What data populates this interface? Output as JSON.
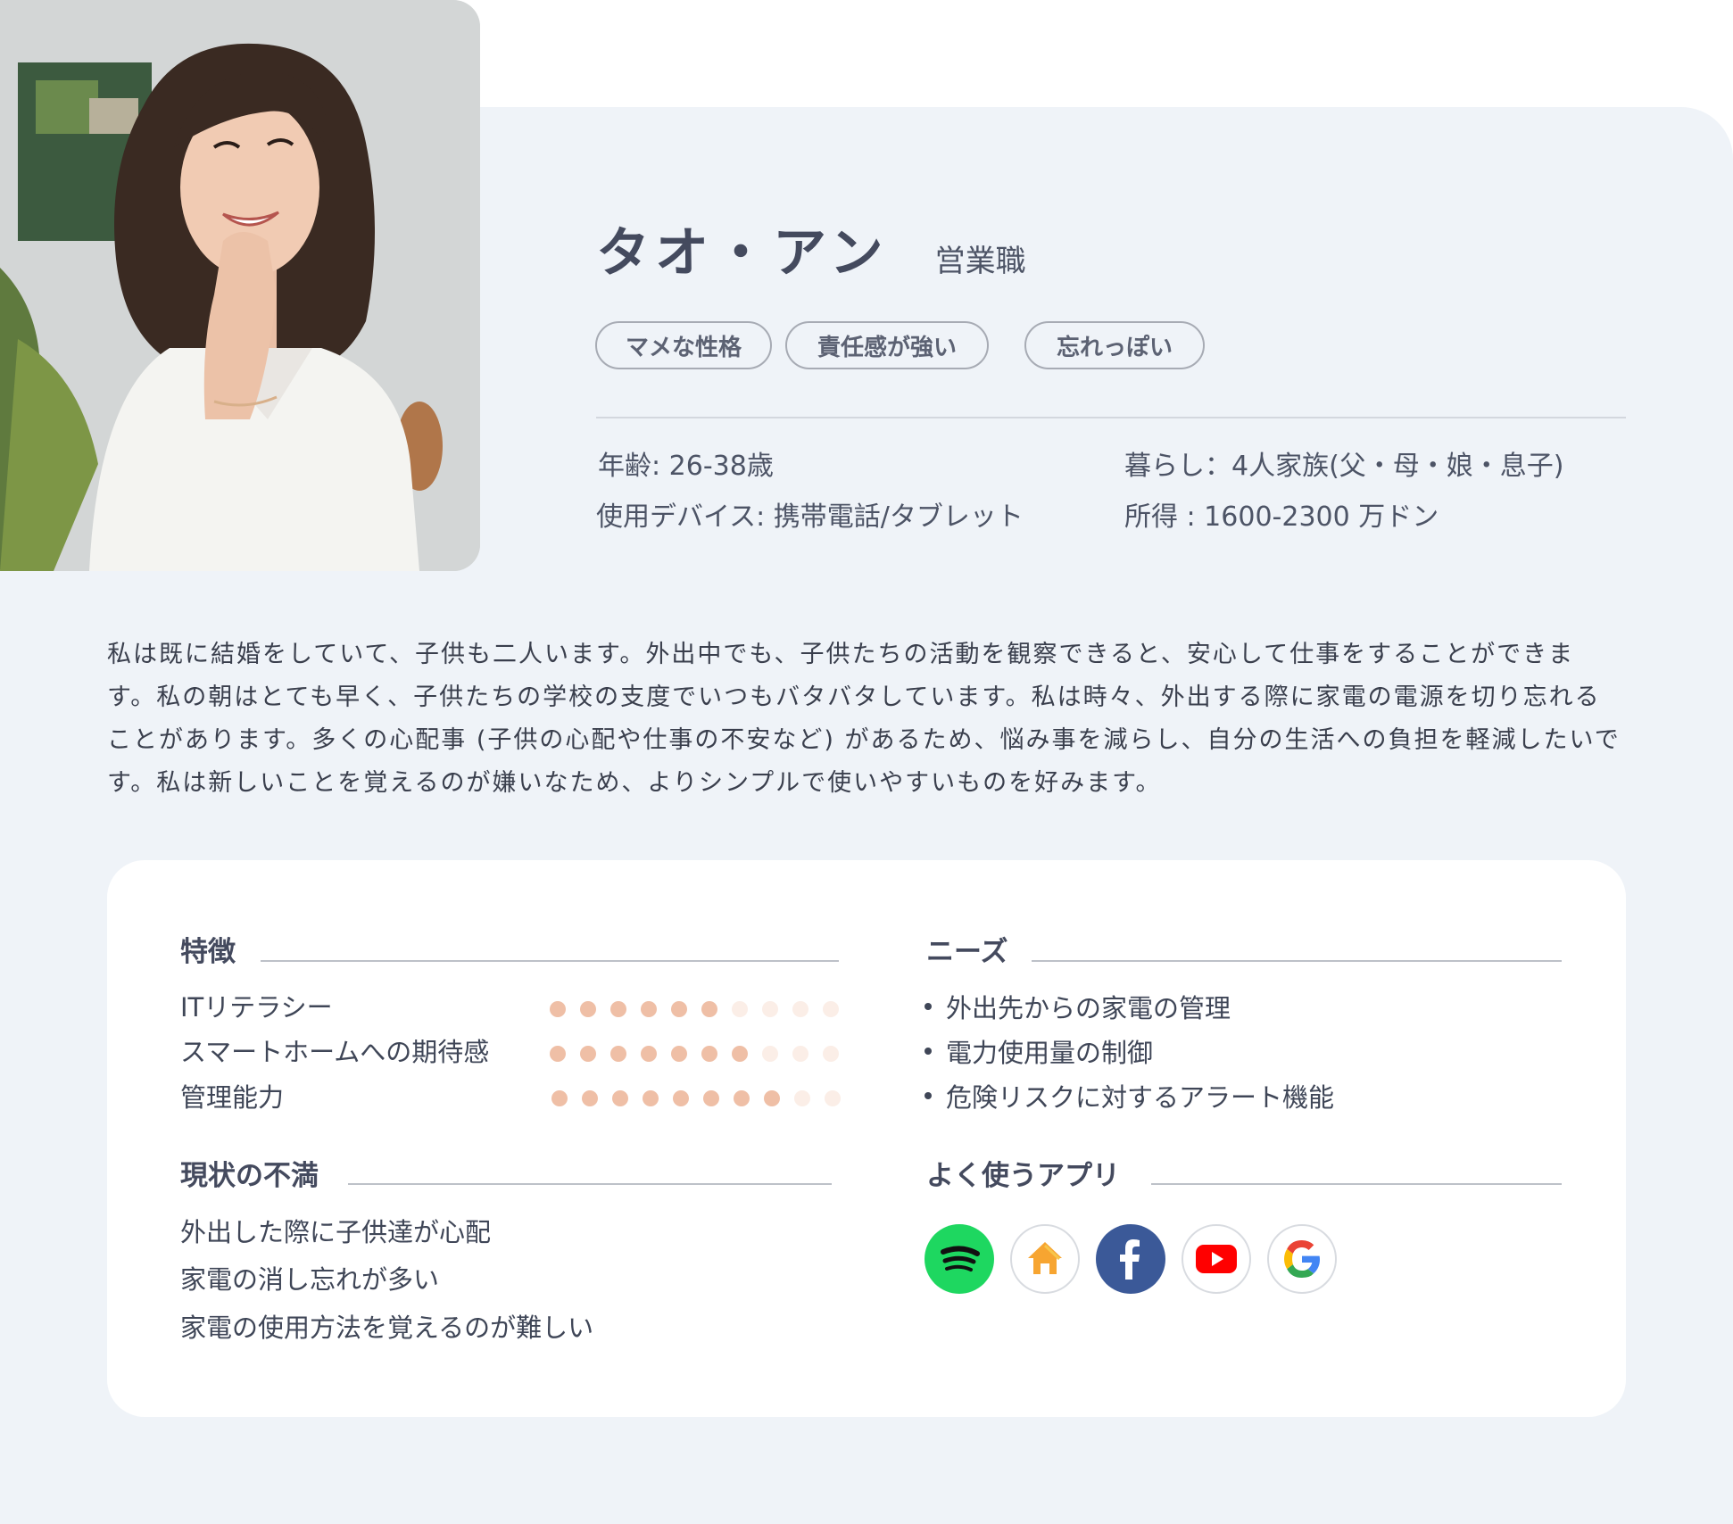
{
  "profile": {
    "name": "タオ・アン",
    "role": "営業職",
    "photo_icon": "portrait-photo",
    "tags": [
      "マメな性格",
      "責任感が強い",
      "忘れっぽい"
    ],
    "age": "年齢: 26-38歳",
    "devices": "使用デバイス: 携帯電話/タブレット",
    "living": "暮らし：4人家族(父・母・娘・息子)",
    "income": "所得 : 1600-2300 万ドン"
  },
  "bio": [
    "私は既に結婚をしていて、子供も二人います。外出中でも、子供たちの活動を観察できると、安心して仕事をすることができま",
    "す。私の朝はとても早く、子供たちの学校の支度でいつもバタバタしています。私は時々、外出する際に家電の電源を切り忘れる",
    "ことがあります。多くの心配事 (子供の心配や仕事の不安など) があるため、悩み事を減らし、自分の生活への負担を軽減したいで",
    "す。私は新しいことを覚えるのが嫌いなため、よりシンプルで使いやすいものを好みます。"
  ],
  "traits": {
    "title": "特徴",
    "items": [
      {
        "label": "ITリテラシー",
        "level": 6,
        "max": 10
      },
      {
        "label": "スマートホームへの期待感",
        "level": 7,
        "max": 10
      },
      {
        "label": "管理能力",
        "level": 8,
        "max": 10
      }
    ],
    "accent_color": "#efbfa6"
  },
  "needs": {
    "title": "ニーズ",
    "items": [
      "外出先からの家電の管理",
      "電力使用量の制御",
      "危険リスクに対するアラート機能"
    ]
  },
  "frustrations": {
    "title": "現状の不満",
    "items": [
      "外出した際に子供達が心配",
      "家電の消し忘れが多い",
      "家電の使用方法を覚えるのが難しい"
    ]
  },
  "apps": {
    "title": "よく使うアプリ",
    "icons": [
      "spotify-icon",
      "home-icon",
      "facebook-icon",
      "youtube-icon",
      "google-icon"
    ]
  }
}
